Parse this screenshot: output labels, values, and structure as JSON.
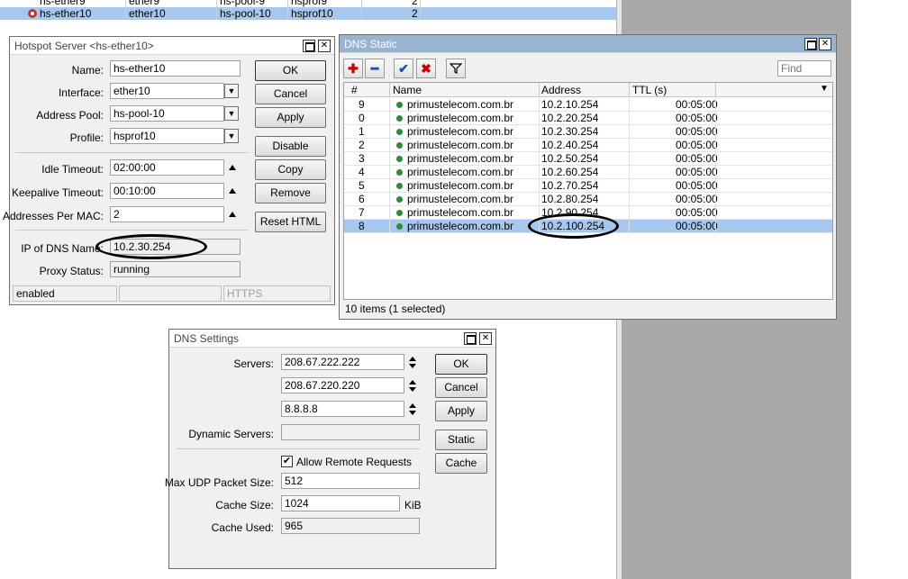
{
  "background_table": {
    "rows": [
      {
        "name": "hs-ether9",
        "interface": "ether9",
        "pool": "hs-pool-9",
        "profile": "hsprof9",
        "count": "2",
        "selected": false
      },
      {
        "name": "hs-ether10",
        "interface": "ether10",
        "pool": "hs-pool-10",
        "profile": "hsprof10",
        "count": "2",
        "selected": true
      }
    ]
  },
  "hotspot": {
    "title": "Hotspot Server <hs-ether10>",
    "fields": {
      "name_label": "Name:",
      "name_value": "hs-ether10",
      "interface_label": "Interface:",
      "interface_value": "ether10",
      "pool_label": "Address Pool:",
      "pool_value": "hs-pool-10",
      "profile_label": "Profile:",
      "profile_value": "hsprof10",
      "idle_label": "Idle Timeout:",
      "idle_value": "02:00:00",
      "keepalive_label": "Keepalive Timeout:",
      "keepalive_value": "00:10:00",
      "addrmac_label": "Addresses Per MAC:",
      "addrmac_value": "2",
      "dnsname_label": "IP of DNS Name:",
      "dnsname_value": "10.2.30.254",
      "proxy_label": "Proxy Status:",
      "proxy_value": "running"
    },
    "buttons": {
      "ok": "OK",
      "cancel": "Cancel",
      "apply": "Apply",
      "disable": "Disable",
      "copy": "Copy",
      "remove": "Remove",
      "reset_html": "Reset HTML"
    },
    "status": {
      "state": "enabled",
      "cell2": "",
      "cell3": "HTTPS"
    }
  },
  "dns_static": {
    "title": "DNS Static",
    "find_placeholder": "Find",
    "columns": {
      "num": "#",
      "name": "Name",
      "address": "Address",
      "ttl": "TTL (s)"
    },
    "rows": [
      {
        "num": "9",
        "name": "primustelecom.com.br",
        "address": "10.2.10.254",
        "ttl": "00:05:00"
      },
      {
        "num": "0",
        "name": "primustelecom.com.br",
        "address": "10.2.20.254",
        "ttl": "00:05:00"
      },
      {
        "num": "1",
        "name": "primustelecom.com.br",
        "address": "10.2.30.254",
        "ttl": "00:05:00"
      },
      {
        "num": "2",
        "name": "primustelecom.com.br",
        "address": "10.2.40.254",
        "ttl": "00:05:00"
      },
      {
        "num": "3",
        "name": "primustelecom.com.br",
        "address": "10.2.50.254",
        "ttl": "00:05:00"
      },
      {
        "num": "4",
        "name": "primustelecom.com.br",
        "address": "10.2.60.254",
        "ttl": "00:05:00"
      },
      {
        "num": "5",
        "name": "primustelecom.com.br",
        "address": "10.2.70.254",
        "ttl": "00:05:00"
      },
      {
        "num": "6",
        "name": "primustelecom.com.br",
        "address": "10.2.80.254",
        "ttl": "00:05:00"
      },
      {
        "num": "7",
        "name": "primustelecom.com.br",
        "address": "10.2.90.254",
        "ttl": "00:05:00"
      },
      {
        "num": "8",
        "name": "primustelecom.com.br",
        "address": "10.2.100.254",
        "ttl": "00:05:00"
      }
    ],
    "selected_index": 9,
    "status": "10 items (1 selected)",
    "toolbar_icons": [
      "add-icon",
      "remove-icon",
      "enable-icon",
      "disable-icon",
      "filter-icon"
    ]
  },
  "dns_settings": {
    "title": "DNS Settings",
    "servers_label": "Servers:",
    "servers": [
      "208.67.222.222",
      "208.67.220.220",
      "8.8.8.8"
    ],
    "dynamic_label": "Dynamic Servers:",
    "dynamic_value": "",
    "allow_remote": "Allow Remote Requests",
    "allow_remote_checked": true,
    "udp_label": "Max UDP Packet Size:",
    "udp_value": "512",
    "cache_size_label": "Cache Size:",
    "cache_size_value": "1024",
    "cache_size_unit": "KiB",
    "cache_used_label": "Cache Used:",
    "cache_used_value": "965",
    "buttons": {
      "ok": "OK",
      "cancel": "Cancel",
      "apply": "Apply",
      "static": "Static",
      "cache": "Cache"
    }
  },
  "colors": {
    "selection": "#a6c8ee",
    "active_title": "#99b4d1",
    "status_dot": "#2e8b3a",
    "add_red": "#cc0000",
    "check_blue": "#1a4fb5"
  }
}
